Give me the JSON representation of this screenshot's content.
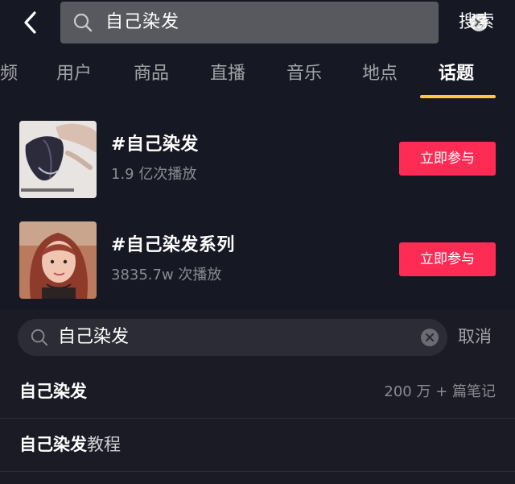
{
  "search": {
    "query": "自己染发",
    "action_label": "搜索"
  },
  "tabs": [
    {
      "label": "频"
    },
    {
      "label": "用户"
    },
    {
      "label": "商品"
    },
    {
      "label": "直播"
    },
    {
      "label": "音乐"
    },
    {
      "label": "地点"
    },
    {
      "label": "话题",
      "active": true
    }
  ],
  "topics": [
    {
      "title": "#自己染发",
      "meta": "1.9 亿次播放",
      "button": "立即参与"
    },
    {
      "title": "#自己染发系列",
      "meta": "3835.7w 次播放",
      "button": "立即参与"
    }
  ],
  "panel": {
    "query": "自己染发",
    "cancel_label": "取消",
    "suggestions": [
      {
        "main": "自己染发",
        "suffix": "",
        "count": "200 万 + 篇笔记"
      },
      {
        "main": "自己染发",
        "suffix": "教程",
        "count": ""
      }
    ]
  },
  "colors": {
    "accent_tab": "#fcc93d",
    "button": "#fe2c55",
    "background": "#161823"
  }
}
